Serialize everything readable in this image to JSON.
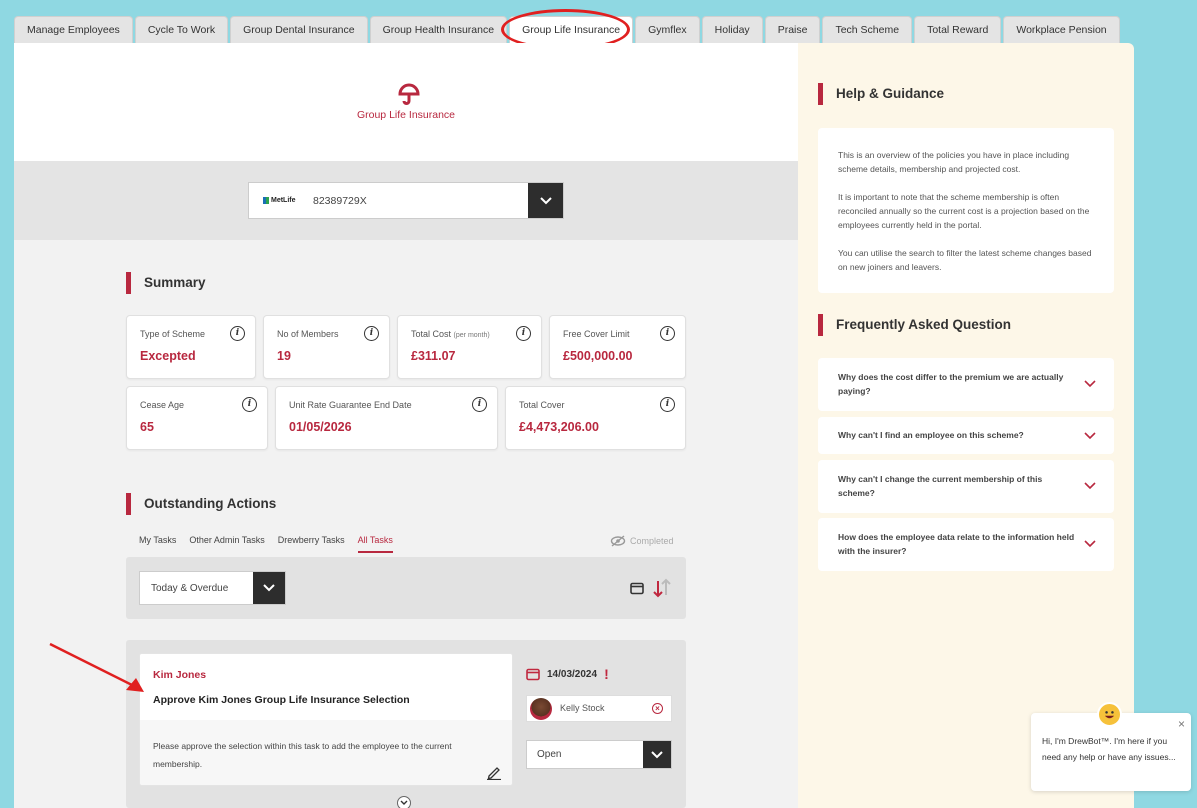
{
  "tabs": [
    {
      "label": "Manage Employees",
      "active": false
    },
    {
      "label": "Cycle To Work",
      "active": false
    },
    {
      "label": "Group Dental Insurance",
      "active": false
    },
    {
      "label": "Group Health Insurance",
      "active": false
    },
    {
      "label": "Group Life Insurance",
      "active": true
    },
    {
      "label": "Gymflex",
      "active": false
    },
    {
      "label": "Holiday",
      "active": false
    },
    {
      "label": "Praise",
      "active": false
    },
    {
      "label": "Tech Scheme",
      "active": false
    },
    {
      "label": "Total Reward",
      "active": false
    },
    {
      "label": "Workplace Pension",
      "active": false
    }
  ],
  "hero": {
    "title": "Group Life Insurance",
    "icon": "umbrella-icon"
  },
  "policy": {
    "provider": "MetLife",
    "number": "82389729X"
  },
  "summary": {
    "title": "Summary",
    "cards": [
      {
        "label": "Type of Scheme",
        "value": "Excepted"
      },
      {
        "label": "No of Members",
        "value": "19"
      },
      {
        "label": "Total Cost",
        "sublabel": "(per month)",
        "value": "£311.07"
      },
      {
        "label": "Free Cover Limit",
        "value": "£500,000.00"
      },
      {
        "label": "Cease Age",
        "value": "65"
      },
      {
        "label": "Unit Rate Guarantee End Date",
        "value": "01/05/2026"
      },
      {
        "label": "Total Cover",
        "value": "£4,473,206.00"
      }
    ],
    "info_glyph": "i"
  },
  "actions": {
    "title": "Outstanding Actions",
    "tabs": [
      "My Tasks",
      "Other Admin Tasks",
      "Drewberry Tasks",
      "All Tasks"
    ],
    "active_tab": "All Tasks",
    "completed_label": "Completed",
    "filter_value": "Today & Overdue",
    "task": {
      "person": "Kim Jones",
      "title": "Approve Kim Jones Group Life Insurance Selection",
      "description": "Please approve the selection within this task to add the employee to the current membership.",
      "date": "14/03/2024",
      "urgent_mark": "!",
      "assignee": "Kelly Stock",
      "status": "Open"
    }
  },
  "help": {
    "title": "Help & Guidance",
    "paragraphs": [
      "This is an overview of the policies you have in place including scheme details, membership and projected cost.",
      "It is important to note that the scheme membership is often reconciled annually so the current cost is a projection based on the employees currently held in the portal.",
      "You can utilise the search to filter the latest scheme changes based on new joiners and leavers."
    ],
    "faq_title": "Frequently Asked Question",
    "faq": [
      "Why does the cost differ to the premium we are actually paying?",
      "Why can't I find an employee on this scheme?",
      "Why can't I change the current membership of this scheme?",
      "How does the employee data relate to the information held with the insurer?"
    ]
  },
  "chat": {
    "message": "Hi, I'm DrewBot™. I'm here if you need any help or have any issues...",
    "close": "×"
  },
  "colors": {
    "accent": "#b8283f",
    "background": "#8fd8e2",
    "panel": "#fdf7e8",
    "annotation": "#e02020"
  }
}
